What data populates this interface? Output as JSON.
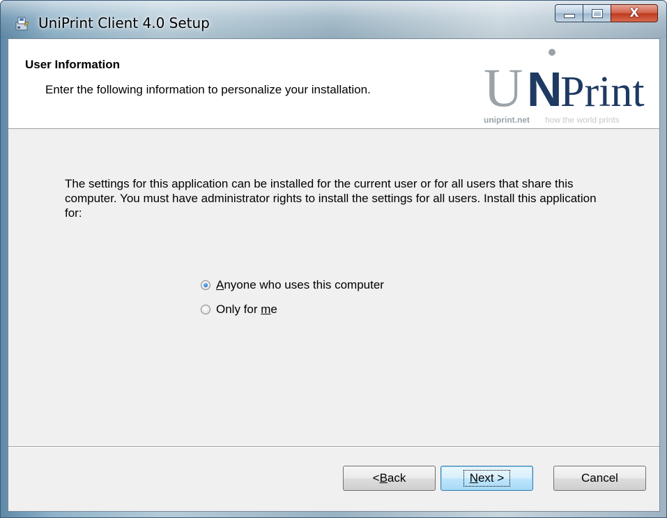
{
  "window": {
    "title": "UniPrint Client 4.0 Setup",
    "icon": "setup-installer-icon"
  },
  "caption_buttons": {
    "minimize_icon": "minimize-icon",
    "maximize_icon": "maximize-icon",
    "close_icon": "close-icon",
    "close_glyph": "X"
  },
  "banner": {
    "title": "User Information",
    "description": "Enter the following information to personalize your installation.",
    "logo": {
      "brand_left": "U",
      "brand_n": "N",
      "brand_right": "Print",
      "domain": "uniprint.net",
      "tagline": "how the world prints",
      "colors": {
        "gray": "#9aa3a8",
        "navy": "#1e3a62"
      }
    }
  },
  "body": {
    "text": "The settings for this application can be installed for the current user or for all users that share this computer. You must have administrator rights to install the settings for all users. Install this application for:"
  },
  "install_for": {
    "options": [
      {
        "label_prefix": "",
        "accel": "A",
        "label_rest": "nyone who uses this computer",
        "selected": true
      },
      {
        "label_prefix": "Only for ",
        "accel": "m",
        "label_rest": "e",
        "selected": false
      }
    ]
  },
  "buttons": {
    "back": {
      "prefix": "< ",
      "accel": "B",
      "rest": "ack"
    },
    "next": {
      "accel": "N",
      "rest": "ext >"
    },
    "cancel": "Cancel"
  },
  "colors": {
    "accent_focus": "#3c7fb1",
    "radio_selected": "#2a7fd0"
  }
}
